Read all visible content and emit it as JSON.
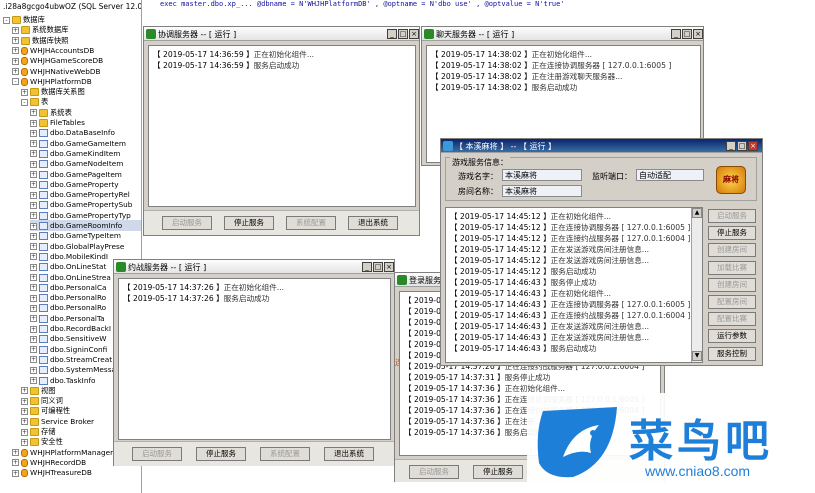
{
  "code_line": "exec master.dbo.xp_... @dbname = N'WHJHPlatformDB' , @optname = N'dbo use' , @optvalue = N'true'",
  "explorer": {
    "header": ".i28a8gcgo4ubwOZ (SQL Server 12.0",
    "nodes": [
      {
        "label": "数据库",
        "depth": 0,
        "toggle": "-",
        "icon": "folder"
      },
      {
        "label": "系统数据库",
        "depth": 1,
        "toggle": "+",
        "icon": "folder"
      },
      {
        "label": "数据库快照",
        "depth": 1,
        "toggle": "+",
        "icon": "folder"
      },
      {
        "label": "WHJHAccountsDB",
        "depth": 1,
        "toggle": "+",
        "icon": "db"
      },
      {
        "label": "WHJHGameScoreDB",
        "depth": 1,
        "toggle": "+",
        "icon": "db"
      },
      {
        "label": "WHJHNativeWebDB",
        "depth": 1,
        "toggle": "+",
        "icon": "db"
      },
      {
        "label": "WHJHPlatformDB",
        "depth": 1,
        "toggle": "-",
        "icon": "db"
      },
      {
        "label": "数据库关系图",
        "depth": 2,
        "toggle": "+",
        "icon": "folder"
      },
      {
        "label": "表",
        "depth": 2,
        "toggle": "-",
        "icon": "folder"
      },
      {
        "label": "系统表",
        "depth": 3,
        "toggle": "+",
        "icon": "folder"
      },
      {
        "label": "FileTables",
        "depth": 3,
        "toggle": "+",
        "icon": "folder"
      },
      {
        "label": "dbo.DataBaseInfo",
        "depth": 3,
        "toggle": "+",
        "icon": "table"
      },
      {
        "label": "dbo.GameGameItem",
        "depth": 3,
        "toggle": "+",
        "icon": "table"
      },
      {
        "label": "dbo.GameKindItem",
        "depth": 3,
        "toggle": "+",
        "icon": "table"
      },
      {
        "label": "dbo.GameNodeItem",
        "depth": 3,
        "toggle": "+",
        "icon": "table"
      },
      {
        "label": "dbo.GamePageItem",
        "depth": 3,
        "toggle": "+",
        "icon": "table"
      },
      {
        "label": "dbo.GameProperty",
        "depth": 3,
        "toggle": "+",
        "icon": "table"
      },
      {
        "label": "dbo.GamePropertyRel",
        "depth": 3,
        "toggle": "+",
        "icon": "table"
      },
      {
        "label": "dbo.GamePropertySub",
        "depth": 3,
        "toggle": "+",
        "icon": "table"
      },
      {
        "label": "dbo.GamePropertyTyp",
        "depth": 3,
        "toggle": "+",
        "icon": "table"
      },
      {
        "label": "dbo.GameRoomInfo",
        "depth": 3,
        "toggle": "+",
        "icon": "table",
        "selected": true
      },
      {
        "label": "dbo.GameTypeItem",
        "depth": 3,
        "toggle": "+",
        "icon": "table"
      },
      {
        "label": "dbo.GlobalPlayPrese",
        "depth": 3,
        "toggle": "+",
        "icon": "table"
      },
      {
        "label": "dbo.MobileKindI",
        "depth": 3,
        "toggle": "+",
        "icon": "table"
      },
      {
        "label": "dbo.OnLineStat",
        "depth": 3,
        "toggle": "+",
        "icon": "table"
      },
      {
        "label": "dbo.OnLineStrea",
        "depth": 3,
        "toggle": "+",
        "icon": "table"
      },
      {
        "label": "dbo.PersonalCa",
        "depth": 3,
        "toggle": "+",
        "icon": "table"
      },
      {
        "label": "dbo.PersonalRo",
        "depth": 3,
        "toggle": "+",
        "icon": "table"
      },
      {
        "label": "dbo.PersonalRo",
        "depth": 3,
        "toggle": "+",
        "icon": "table"
      },
      {
        "label": "dbo.PersonalTa",
        "depth": 3,
        "toggle": "+",
        "icon": "table"
      },
      {
        "label": "dbo.RecordBackI",
        "depth": 3,
        "toggle": "+",
        "icon": "table"
      },
      {
        "label": "dbo.SensitiveW",
        "depth": 3,
        "toggle": "+",
        "icon": "table"
      },
      {
        "label": "dbo.SigninConfi",
        "depth": 3,
        "toggle": "+",
        "icon": "table"
      },
      {
        "label": "dbo.StreamCreat",
        "depth": 3,
        "toggle": "+",
        "icon": "table"
      },
      {
        "label": "dbo.SystemMessa",
        "depth": 3,
        "toggle": "+",
        "icon": "table"
      },
      {
        "label": "dbo.TaskInfo",
        "depth": 3,
        "toggle": "+",
        "icon": "table"
      },
      {
        "label": "视图",
        "depth": 2,
        "toggle": "+",
        "icon": "folder"
      },
      {
        "label": "同义词",
        "depth": 2,
        "toggle": "+",
        "icon": "folder"
      },
      {
        "label": "可编程性",
        "depth": 2,
        "toggle": "+",
        "icon": "folder"
      },
      {
        "label": "Service Broker",
        "depth": 2,
        "toggle": "+",
        "icon": "folder"
      },
      {
        "label": "存储",
        "depth": 2,
        "toggle": "+",
        "icon": "folder"
      },
      {
        "label": "安全性",
        "depth": 2,
        "toggle": "+",
        "icon": "folder"
      },
      {
        "label": "WHJHPlatformManagerDB",
        "depth": 1,
        "toggle": "+",
        "icon": "db"
      },
      {
        "label": "WHJHRecordDB",
        "depth": 1,
        "toggle": "+",
        "icon": "db"
      },
      {
        "label": "WHJHTreasureDB",
        "depth": 1,
        "toggle": "+",
        "icon": "db"
      }
    ]
  },
  "win_coordinator": {
    "title": "协调服务器 -- [ 运行 ]",
    "logs": [
      {
        "time": "【 2019-05-17 14:36:59 】",
        "msg": "正在初始化组件..."
      },
      {
        "time": "【 2019-05-17 14:36:59 】",
        "msg": "服务启动成功"
      }
    ],
    "buttons": [
      {
        "label": "启动服务",
        "disabled": true
      },
      {
        "label": "停止服务",
        "disabled": false
      },
      {
        "label": "系统配置",
        "disabled": true
      },
      {
        "label": "退出系统",
        "disabled": false
      }
    ]
  },
  "win_chat": {
    "title": "聊天服务器 -- [ 运行 ]",
    "logs": [
      {
        "time": "【 2019-05-17 14:38:02 】",
        "msg": "正在初始化组件..."
      },
      {
        "time": "【 2019-05-17 14:38:02 】",
        "msg": "正在连接协调服务器 [ 127.0.0.1:6005 ]"
      },
      {
        "time": "【 2019-05-17 14:38:02 】",
        "msg": "正在注册游戏聊天服务器..."
      },
      {
        "time": "【 2019-05-17 14:38:02 】",
        "msg": "服务启动成功"
      }
    ]
  },
  "win_room": {
    "title": "【 本溪麻将 】 -- 【 运行 】",
    "group_label": "游戏服务信息：",
    "game_name_label": "游戏名字：",
    "game_name_value": "本溪麻将",
    "port_label": "监听端口：",
    "port_value": "自动适配",
    "room_name_label": "房间名称：",
    "room_name_value": "本溪麻将",
    "logs": [
      {
        "time": "【 2019-05-17 14:45:12 】",
        "msg": "正在初始化组件..."
      },
      {
        "time": "【 2019-05-17 14:45:12 】",
        "msg": "正在连接协调服务器 [ 127.0.0.1:6005 ]"
      },
      {
        "time": "【 2019-05-17 14:45:12 】",
        "msg": "正在连接约战服务器 [ 127.0.0.1:6004 ]"
      },
      {
        "time": "【 2019-05-17 14:45:12 】",
        "msg": "正在发送游戏房间注册信息..."
      },
      {
        "time": "【 2019-05-17 14:45:12 】",
        "msg": "正在发送游戏房间注册信息..."
      },
      {
        "time": "【 2019-05-17 14:45:12 】",
        "msg": "服务启动成功"
      },
      {
        "time": "【 2019-05-17 14:46:43 】",
        "msg": "服务停止成功"
      },
      {
        "time": "【 2019-05-17 14:46:43 】",
        "msg": "正在初始化组件..."
      },
      {
        "time": "【 2019-05-17 14:46:43 】",
        "msg": "正在连接协调服务器 [ 127.0.0.1:6005 ]"
      },
      {
        "time": "【 2019-05-17 14:46:43 】",
        "msg": "正在连接约战服务器 [ 127.0.0.1:6004 ]"
      },
      {
        "time": "【 2019-05-17 14:46:43 】",
        "msg": "正在发送游戏房间注册信息..."
      },
      {
        "time": "【 2019-05-17 14:46:43 】",
        "msg": "正在发送游戏房间注册信息..."
      },
      {
        "time": "【 2019-05-17 14:46:43 】",
        "msg": "服务启动成功"
      }
    ],
    "buttons": [
      {
        "label": "启动服务",
        "disabled": true
      },
      {
        "label": "停止服务",
        "disabled": false
      },
      {
        "label": "创建房间",
        "disabled": true
      },
      {
        "label": "加载比赛",
        "disabled": true
      },
      {
        "label": "创建房间",
        "disabled": true
      },
      {
        "label": "配置房间",
        "disabled": true
      },
      {
        "label": "配置比赛",
        "disabled": true
      },
      {
        "label": "运行参数",
        "disabled": false
      },
      {
        "label": "服务控制",
        "disabled": false
      }
    ],
    "logo_text": "麻将"
  },
  "win_match": {
    "title": "约战服务器 -- [ 运行 ]",
    "logs": [
      {
        "time": "【 2019-05-17 14:37:26 】",
        "msg": "正在初始化组件..."
      },
      {
        "time": "【 2019-05-17 14:37:26 】",
        "msg": "服务启动成功"
      }
    ],
    "buttons": [
      {
        "label": "启动服务",
        "disabled": true
      },
      {
        "label": "停止服务",
        "disabled": false
      },
      {
        "label": "系统配置",
        "disabled": true
      },
      {
        "label": "退出系统",
        "disabled": false
      }
    ]
  },
  "win_login": {
    "title": "登录服务器",
    "side_label": "连接",
    "logs_top": [
      {
        "time": "【 2019-05-",
        "msg": ""
      },
      {
        "time": "【 2019-05-",
        "msg": ""
      },
      {
        "time": "【 2019-05-",
        "msg": ""
      },
      {
        "time": "【 2019-05-",
        "msg": ""
      },
      {
        "time": "【 2019-05-",
        "msg": ""
      },
      {
        "time": "【 2019-05-",
        "msg": ""
      }
    ],
    "logs": [
      {
        "time": "【 2019-05-17 14:37:26 】",
        "msg": "正在连接约战服务器 [ 127.0.0.1:6004 ]"
      },
      {
        "time": "【 2019-05-17 14:37:31 】",
        "msg": "服务停止成功"
      },
      {
        "time": "【 2019-05-17 14:37:36 】",
        "msg": "正在初始化组件..."
      },
      {
        "time": "【 2019-05-17 14:37:36 】",
        "msg": "正在连接协调服务器 [ 127.0.0.1:6005 ]"
      },
      {
        "time": "【 2019-05-17 14:37:36 】",
        "msg": "正在连接约战服务器 [ 127.0.0.1:6004 ]"
      },
      {
        "time": "【 2019-05-17 14:37:36 】",
        "msg": "正在注册..."
      },
      {
        "time": "【 2019-05-17 14:37:36 】",
        "msg": "服务启动成功"
      }
    ],
    "buttons": [
      {
        "label": "启动服务",
        "disabled": true
      },
      {
        "label": "停止服务",
        "disabled": false
      }
    ]
  },
  "watermark": {
    "brand": "菜鸟吧",
    "url": "www.cniao8.com"
  }
}
